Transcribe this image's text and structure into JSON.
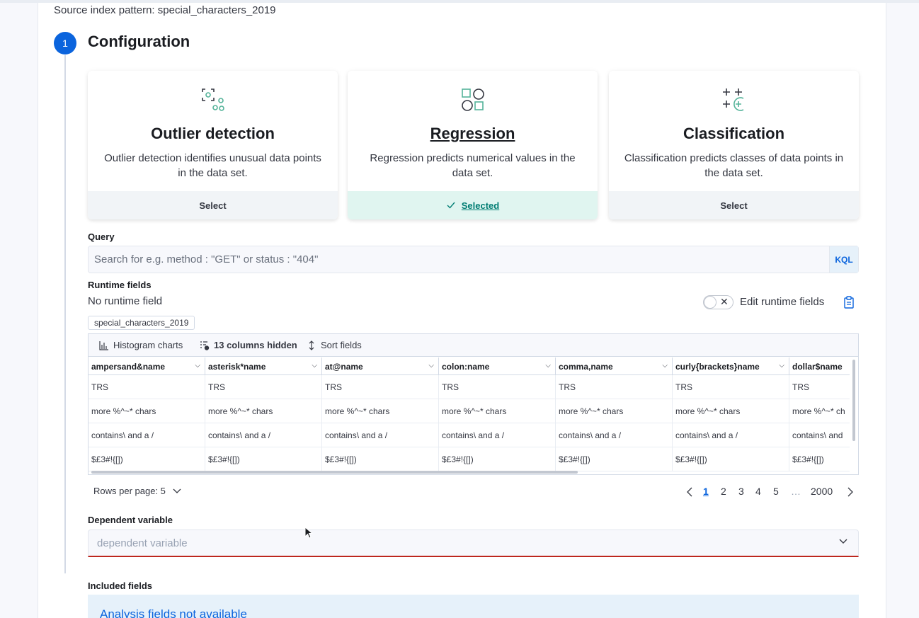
{
  "source": {
    "text": "Source index pattern: special_characters_2019"
  },
  "step": {
    "number": "1",
    "title": "Configuration"
  },
  "cards": [
    {
      "title": "Outlier detection",
      "desc": "Outlier detection identifies unusual data points in the data set.",
      "action": "Select",
      "selected": false,
      "icon": "outlier-detection-icon"
    },
    {
      "title": "Regression",
      "desc": "Regression predicts numerical values in the data set.",
      "action": "Selected",
      "selected": true,
      "icon": "regression-icon"
    },
    {
      "title": "Classification",
      "desc": "Classification predicts classes of data points in the data set.",
      "action": "Select",
      "selected": false,
      "icon": "classification-icon"
    }
  ],
  "query": {
    "label": "Query",
    "placeholder": "Search for e.g. method : \"GET\" or status : \"404\"",
    "value": "",
    "kql": "KQL"
  },
  "runtime": {
    "label": "Runtime fields",
    "empty_text": "No runtime field",
    "edit_label": "Edit runtime fields"
  },
  "index_badge": "special_characters_2019",
  "grid": {
    "toolbar": {
      "histogram": "Histogram charts",
      "hidden": "13 columns hidden",
      "sort": "Sort fields"
    },
    "columns": [
      "ampersand&name",
      "asterisk*name",
      "at@name",
      "colon:name",
      "comma,name",
      "curly{brackets}name",
      "dollar$name"
    ],
    "rows": [
      [
        "TRS",
        "TRS",
        "TRS",
        "TRS",
        "TRS",
        "TRS",
        "TRS"
      ],
      [
        "more %^~* chars",
        "more %^~* chars",
        "more %^~* chars",
        "more %^~* chars",
        "more %^~* chars",
        "more %^~* chars",
        "more %^~* ch"
      ],
      [
        "contains\\ and a /",
        "contains\\ and a /",
        "contains\\ and a /",
        "contains\\ and a /",
        "contains\\ and a /",
        "contains\\ and a /",
        "contains\\ and"
      ],
      [
        "$£3#!{[])",
        "$£3#!{[])",
        "$£3#!{[])",
        "$£3#!{[])",
        "$£3#!{[])",
        "$£3#!{[])",
        "$£3#!{[])"
      ]
    ]
  },
  "pagination": {
    "rows_per_page": "Rows per page: 5",
    "pages": [
      "1",
      "2",
      "3",
      "4",
      "5"
    ],
    "ellipsis": "…",
    "last": "2000",
    "active": "1"
  },
  "dependent": {
    "label": "Dependent variable",
    "placeholder": "dependent variable",
    "value": ""
  },
  "included": {
    "label": "Included fields",
    "callout": "Analysis fields not available"
  },
  "colors": {
    "primary": "#0b64dd",
    "success": "#017d73",
    "danger": "#bd271e"
  }
}
